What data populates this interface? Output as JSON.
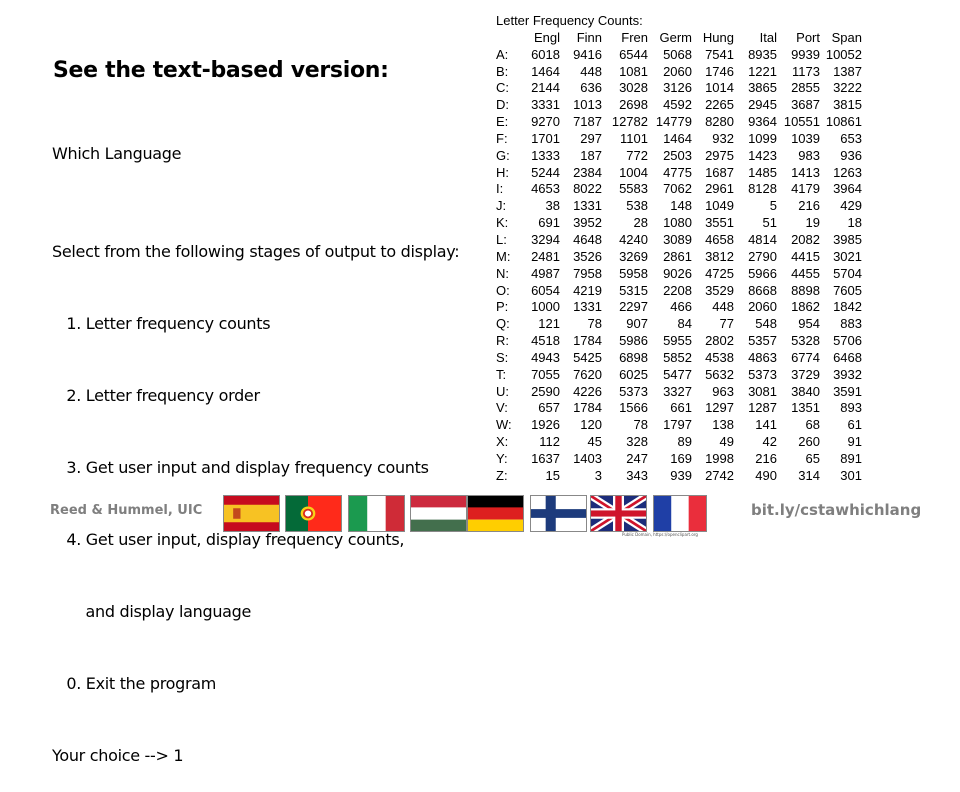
{
  "heading": "See the text-based version:",
  "program_title": "Which Language",
  "menu": {
    "prompt": "Select from the following stages of output to display:",
    "options": [
      "   1. Letter frequency counts",
      "   2. Letter frequency order",
      "   3. Get user input and display frequency counts",
      "   4. Get user input, display frequency counts,",
      "       and display language",
      "   0. Exit the program"
    ],
    "choice_line": "Your choice --> 1"
  },
  "console": {
    "title": "Letter Frequency Counts:",
    "columns": [
      "Engl",
      "Finn",
      "Fren",
      "Germ",
      "Hung",
      "Ital",
      "Port",
      "Span"
    ],
    "rows": [
      {
        "letter": "A:",
        "values": [
          "6018",
          "9416",
          "6544",
          "5068",
          "7541",
          "8935",
          "9939",
          "10052"
        ]
      },
      {
        "letter": "B:",
        "values": [
          "1464",
          "448",
          "1081",
          "2060",
          "1746",
          "1221",
          "1173",
          "1387"
        ]
      },
      {
        "letter": "C:",
        "values": [
          "2144",
          "636",
          "3028",
          "3126",
          "1014",
          "3865",
          "2855",
          "3222"
        ]
      },
      {
        "letter": "D:",
        "values": [
          "3331",
          "1013",
          "2698",
          "4592",
          "2265",
          "2945",
          "3687",
          "3815"
        ]
      },
      {
        "letter": "E:",
        "values": [
          "9270",
          "7187",
          "12782",
          "14779",
          "8280",
          "9364",
          "10551",
          "10861"
        ]
      },
      {
        "letter": "F:",
        "values": [
          "1701",
          "297",
          "1101",
          "1464",
          "932",
          "1099",
          "1039",
          "653"
        ]
      },
      {
        "letter": "G:",
        "values": [
          "1333",
          "187",
          "772",
          "2503",
          "2975",
          "1423",
          "983",
          "936"
        ]
      },
      {
        "letter": "H:",
        "values": [
          "5244",
          "2384",
          "1004",
          "4775",
          "1687",
          "1485",
          "1413",
          "1263"
        ]
      },
      {
        "letter": "I:",
        "values": [
          "4653",
          "8022",
          "5583",
          "7062",
          "2961",
          "8128",
          "4179",
          "3964"
        ]
      },
      {
        "letter": "J:",
        "values": [
          "38",
          "1331",
          "538",
          "148",
          "1049",
          "5",
          "216",
          "429"
        ]
      },
      {
        "letter": "K:",
        "values": [
          "691",
          "3952",
          "28",
          "1080",
          "3551",
          "51",
          "19",
          "18"
        ]
      },
      {
        "letter": "L:",
        "values": [
          "3294",
          "4648",
          "4240",
          "3089",
          "4658",
          "4814",
          "2082",
          "3985"
        ]
      },
      {
        "letter": "M:",
        "values": [
          "2481",
          "3526",
          "3269",
          "2861",
          "3812",
          "2790",
          "4415",
          "3021"
        ]
      },
      {
        "letter": "N:",
        "values": [
          "4987",
          "7958",
          "5958",
          "9026",
          "4725",
          "5966",
          "4455",
          "5704"
        ]
      },
      {
        "letter": "O:",
        "values": [
          "6054",
          "4219",
          "5315",
          "2208",
          "3529",
          "8668",
          "8898",
          "7605"
        ]
      },
      {
        "letter": "P:",
        "values": [
          "1000",
          "1331",
          "2297",
          "466",
          "448",
          "2060",
          "1862",
          "1842"
        ]
      },
      {
        "letter": "Q:",
        "values": [
          "121",
          "78",
          "907",
          "84",
          "77",
          "548",
          "954",
          "883"
        ]
      },
      {
        "letter": "R:",
        "values": [
          "4518",
          "1784",
          "5986",
          "5955",
          "2802",
          "5357",
          "5328",
          "5706"
        ]
      },
      {
        "letter": "S:",
        "values": [
          "4943",
          "5425",
          "6898",
          "5852",
          "4538",
          "4863",
          "6774",
          "6468"
        ]
      },
      {
        "letter": "T:",
        "values": [
          "7055",
          "7620",
          "6025",
          "5477",
          "5632",
          "5373",
          "3729",
          "3932"
        ]
      },
      {
        "letter": "U:",
        "values": [
          "2590",
          "4226",
          "5373",
          "3327",
          "963",
          "3081",
          "3840",
          "3591"
        ]
      },
      {
        "letter": "V:",
        "values": [
          "657",
          "1784",
          "1566",
          "661",
          "1297",
          "1287",
          "1351",
          "893"
        ]
      },
      {
        "letter": "W:",
        "values": [
          "1926",
          "120",
          "78",
          "1797",
          "138",
          "141",
          "68",
          "61"
        ]
      },
      {
        "letter": "X:",
        "values": [
          "112",
          "45",
          "328",
          "89",
          "49",
          "42",
          "260",
          "91"
        ]
      },
      {
        "letter": "Y:",
        "values": [
          "1637",
          "1403",
          "247",
          "169",
          "1998",
          "216",
          "65",
          "891"
        ]
      },
      {
        "letter": "Z:",
        "values": [
          "15",
          "3",
          "343",
          "939",
          "2742",
          "490",
          "314",
          "301"
        ]
      }
    ]
  },
  "footer": {
    "authors": "Reed & Hummel, UIC",
    "link": "bit.ly/cstawhichlang",
    "flags": [
      "spain-flag-icon",
      "portugal-flag-icon",
      "italy-flag-icon",
      "hungary-flag-icon",
      "germany-flag-icon",
      "finland-flag-icon",
      "uk-flag-icon",
      "france-flag-icon"
    ],
    "image_credit": "Public Domain, https://openclipart.org"
  }
}
